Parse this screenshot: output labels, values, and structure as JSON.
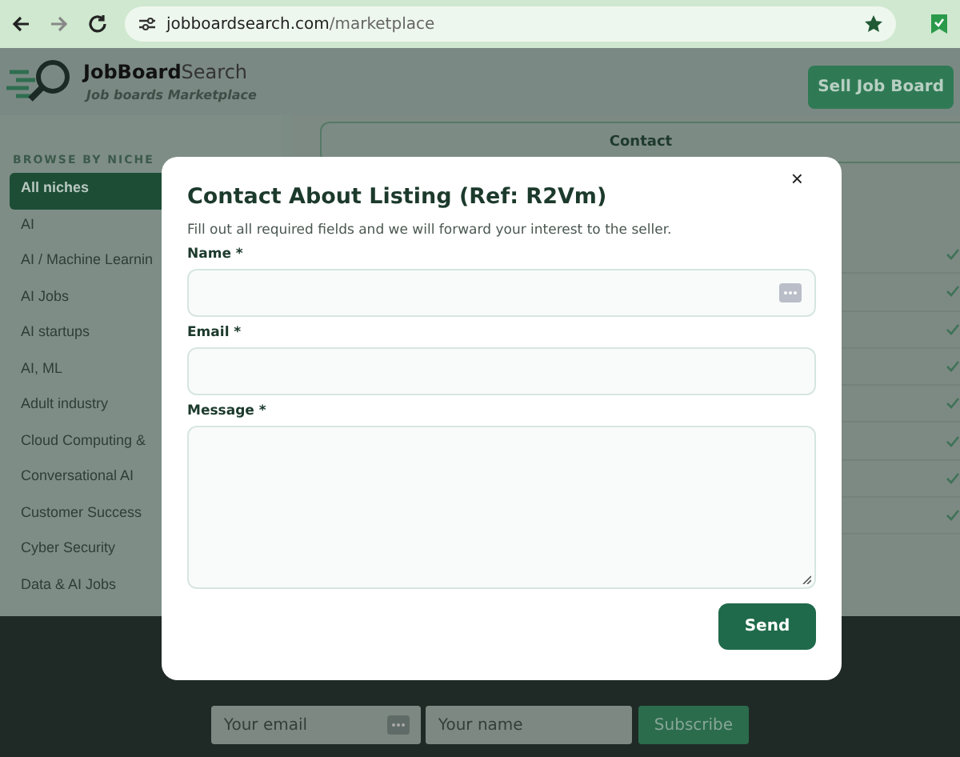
{
  "browser": {
    "url_host": "jobboardsearch.com",
    "url_path": "/marketplace"
  },
  "header": {
    "brand_bold": "JobBoard",
    "brand_rest": "Search",
    "tagline": "Job boards Marketplace",
    "sell_button": "Sell Job Board"
  },
  "sidebar": {
    "heading": "BROWSE BY NICHE",
    "items": [
      {
        "label": "All niches",
        "selected": true
      },
      {
        "label": "AI",
        "selected": false
      },
      {
        "label": "AI / Machine Learnin",
        "selected": false
      },
      {
        "label": "AI Jobs",
        "selected": false
      },
      {
        "label": "AI startups",
        "selected": false
      },
      {
        "label": "AI, ML",
        "selected": false
      },
      {
        "label": "Adult industry",
        "selected": false
      },
      {
        "label": "Cloud Computing &",
        "selected": false
      },
      {
        "label": "Conversational AI",
        "selected": false
      },
      {
        "label": "Customer Success",
        "selected": false
      },
      {
        "label": "Cyber Security",
        "selected": false
      },
      {
        "label": "Data & AI Jobs",
        "selected": false
      }
    ]
  },
  "content": {
    "tab": "Contact",
    "rows": [
      {
        "checked": true
      },
      {
        "checked": true
      },
      {
        "checked": true
      },
      {
        "checked": true
      },
      {
        "checked": true
      },
      {
        "checked": true
      },
      {
        "checked": true
      },
      {
        "checked": true
      }
    ]
  },
  "modal": {
    "close": "×",
    "title": "Contact About Listing (Ref: R2Vm)",
    "description": "Fill out all required fields and we will forward your interest to the seller.",
    "fields": [
      {
        "label": "Name *",
        "kind": "input",
        "autofill_icon": true
      },
      {
        "label": "Email *",
        "kind": "input",
        "autofill_icon": false
      },
      {
        "label": "Message *",
        "kind": "textarea",
        "autofill_icon": false
      }
    ],
    "send_button": "Send"
  },
  "footer": {
    "email_placeholder": "Your email",
    "name_placeholder": "Your name",
    "subscribe_button": "Subscribe"
  }
}
